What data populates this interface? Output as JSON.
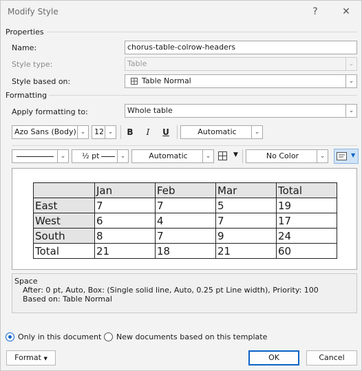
{
  "window": {
    "title": "Modify Style",
    "help_glyph": "?",
    "close_glyph": "✕"
  },
  "properties": {
    "section_label": "Properties",
    "name_label": "Name:",
    "name_value": "chorus-table-colrow-headers",
    "style_type_label": "Style type:",
    "style_type_value": "Table",
    "based_on_label": "Style based on:",
    "based_on_value": "Table Normal",
    "based_on_icon": "table-icon"
  },
  "formatting": {
    "section_label": "Formatting",
    "apply_label": "Apply formatting to:",
    "apply_value": "Whole table",
    "font_value": "Azo Sans (Body)",
    "size_value": "12",
    "bold": "B",
    "italic": "I",
    "underline": "U",
    "font_color": "Automatic",
    "line_weight": "½ pt",
    "border_color": "Automatic",
    "shading": "No Color"
  },
  "preview_table": {
    "rows": [
      [
        "",
        "Jan",
        "Feb",
        "Mar",
        "Total"
      ],
      [
        "East",
        "7",
        "7",
        "5",
        "19"
      ],
      [
        "West",
        "6",
        "4",
        "7",
        "17"
      ],
      [
        "South",
        "8",
        "7",
        "9",
        "24"
      ],
      [
        "Total",
        "21",
        "18",
        "21",
        "60"
      ]
    ]
  },
  "description": {
    "line1": "Space",
    "line2": "After:  0 pt, Auto, Box: (Single solid line, Auto,  0.25 pt Line width), Priority: 100",
    "line3": "Based on: Table Normal"
  },
  "options": {
    "only_this_doc": "Only in this document",
    "new_docs": "New documents based on this template"
  },
  "buttons": {
    "format": "Format",
    "ok": "OK",
    "cancel": "Cancel"
  },
  "colors": {
    "accent": "#0a62c8",
    "header_shading": "#e4e4e4"
  }
}
